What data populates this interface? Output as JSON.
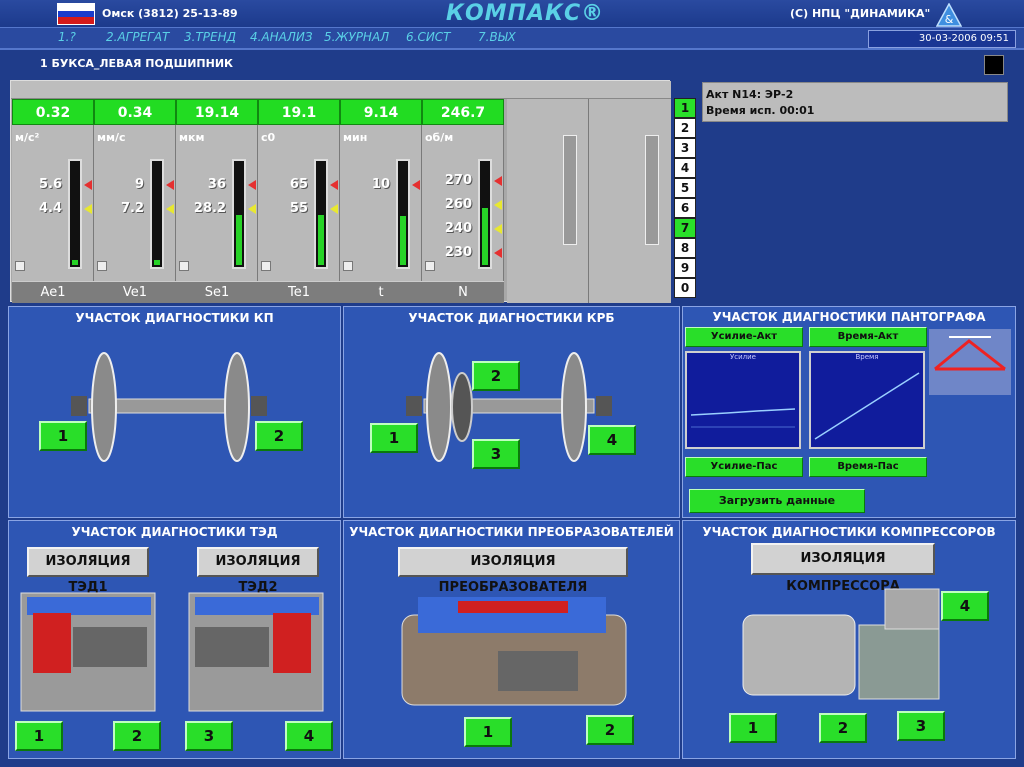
{
  "header": {
    "phone": "Омск (3812) 25-13-89",
    "logo": "КОМПАКС®",
    "copyright": "(С) НПЦ \"ДИНАМИКА\"",
    "datetime": "30-03-2006 09:51"
  },
  "menu": [
    "1.?",
    "2.АГРЕГАТ",
    "3.ТРЕНД",
    "4.АНАЛИЗ",
    "5.ЖУРНАЛ",
    "6.СИСТ",
    "7.ВЫХ"
  ],
  "subtitle": "1 БУКСА_ЛЕВАЯ ПОДШИПНИК",
  "gauges": [
    {
      "value": "0.32",
      "unit": "м/с²",
      "thresholds": [
        "5.6",
        "4.4"
      ],
      "label": "Ae1",
      "level": 0.05
    },
    {
      "value": "0.34",
      "unit": "мм/с",
      "thresholds": [
        "9",
        "7.2"
      ],
      "label": "Ve1",
      "level": 0.05
    },
    {
      "value": "19.14",
      "unit": "мкм",
      "thresholds": [
        "36",
        "28.2"
      ],
      "label": "Se1",
      "level": 0.48
    },
    {
      "value": "19.1",
      "unit": "с0",
      "thresholds": [
        "65",
        "55"
      ],
      "label": "Te1",
      "level": 0.48
    },
    {
      "value": "9.14",
      "unit": "мин",
      "thresholds": [
        "10"
      ],
      "label": "t",
      "level": 0.47
    },
    {
      "value": "246.7",
      "unit": "об/м",
      "thresholds": [
        "270",
        "260",
        "240",
        "230"
      ],
      "label": "N",
      "level": 0.55
    }
  ],
  "channel_numbers": [
    "1",
    "2",
    "3",
    "4",
    "5",
    "6",
    "7",
    "8",
    "9",
    "0"
  ],
  "act": {
    "line1": "Акт N14: ЭР-2",
    "line2": "Время исп. 00:01"
  },
  "sections": {
    "kp": {
      "title": "УЧАСТОК ДИАГНОСТИКИ КП",
      "buttons": [
        "1",
        "2"
      ]
    },
    "krb": {
      "title": "УЧАСТОК ДИАГНОСТИКИ КРБ",
      "buttons": [
        "1",
        "2",
        "3",
        "4"
      ]
    },
    "panto": {
      "title": "УЧАСТОК ДИАГНОСТИКИ ПАНТОГРАФА",
      "btn_force_act": "Усилие-Акт",
      "btn_time_act": "Время-Акт",
      "btn_force_pas": "Усилие-Пас",
      "btn_time_pas": "Время-Пас",
      "chart1_label": "Усилие",
      "chart2_label": "Время",
      "load": "Загрузить данные"
    },
    "ted": {
      "title": "УЧАСТОК ДИАГНОСТИКИ ТЭД",
      "iso1": "ИЗОЛЯЦИЯ ТЭД1",
      "iso2": "ИЗОЛЯЦИЯ ТЭД2",
      "buttons": [
        "1",
        "2",
        "3",
        "4"
      ]
    },
    "conv": {
      "title": "УЧАСТОК ДИАГНОСТИКИ ПРЕОБРАЗОВАТЕЛЕЙ",
      "iso": "ИЗОЛЯЦИЯ ПРЕОБРАЗОВАТЕЛЯ",
      "buttons": [
        "1",
        "2"
      ]
    },
    "comp": {
      "title": "УЧАСТОК ДИАГНОСТИКИ КОМПРЕССОРОВ",
      "iso": "ИЗОЛЯЦИЯ КОМПРЕССОРА",
      "buttons": [
        "4",
        "1",
        "2",
        "3"
      ]
    }
  }
}
